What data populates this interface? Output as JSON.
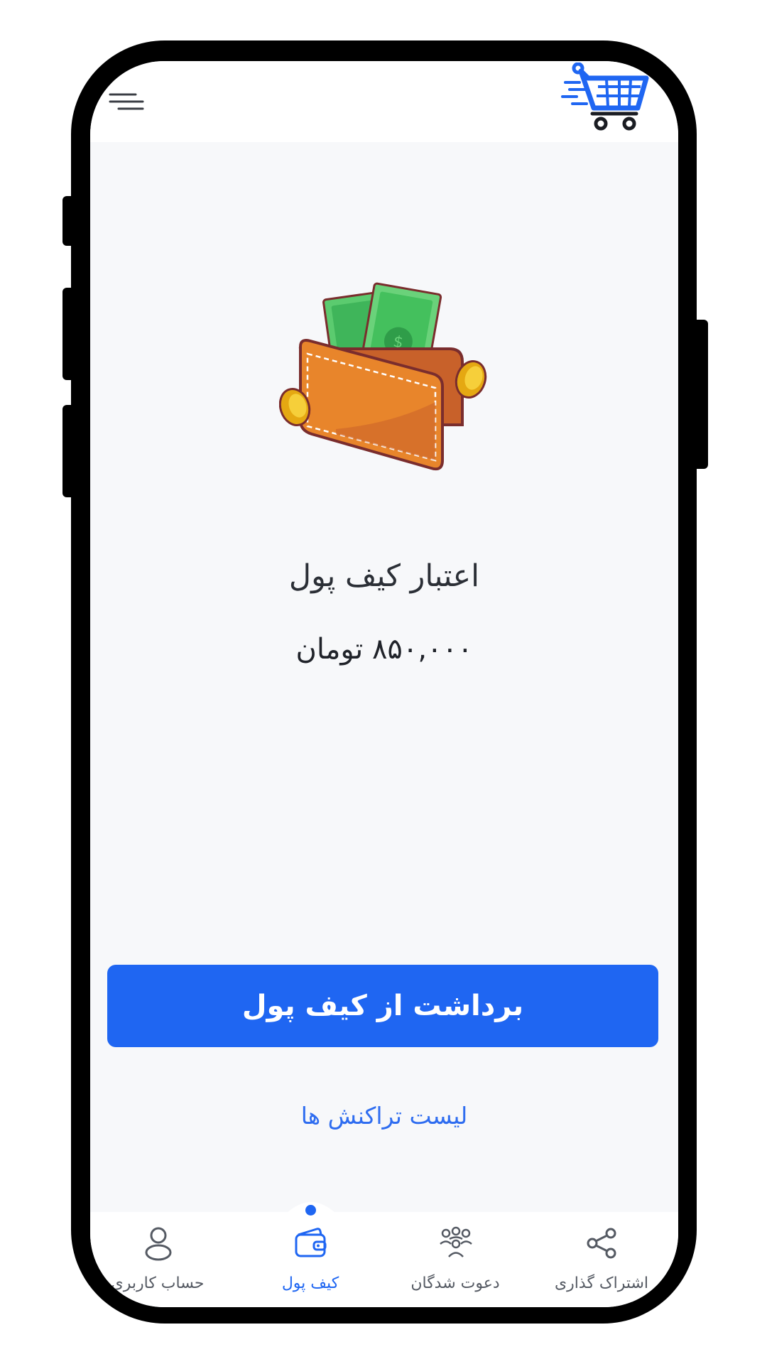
{
  "header": {
    "menu_icon": "hamburger-menu-icon",
    "logo_icon": "shopping-cart-logo-icon"
  },
  "wallet": {
    "illustration": "wallet-with-money-illustration",
    "title": "اعتبار کیف پول",
    "balance": "۸۵۰,۰۰۰ تومان"
  },
  "actions": {
    "withdraw_label": "برداشت از کیف پول",
    "transactions_label": "لیست تراکنش ها"
  },
  "bottom_nav": {
    "active_index": 1,
    "items": [
      {
        "label": "حساب کاربری",
        "icon": "user-icon"
      },
      {
        "label": "کیف پول",
        "icon": "wallet-icon"
      },
      {
        "label": "دعوت شدگان",
        "icon": "group-icon"
      },
      {
        "label": "اشتراک گذاری",
        "icon": "share-icon"
      }
    ]
  },
  "colors": {
    "primary": "#1f66f2",
    "background": "#f7f8fa",
    "text": "#2b2f36"
  }
}
